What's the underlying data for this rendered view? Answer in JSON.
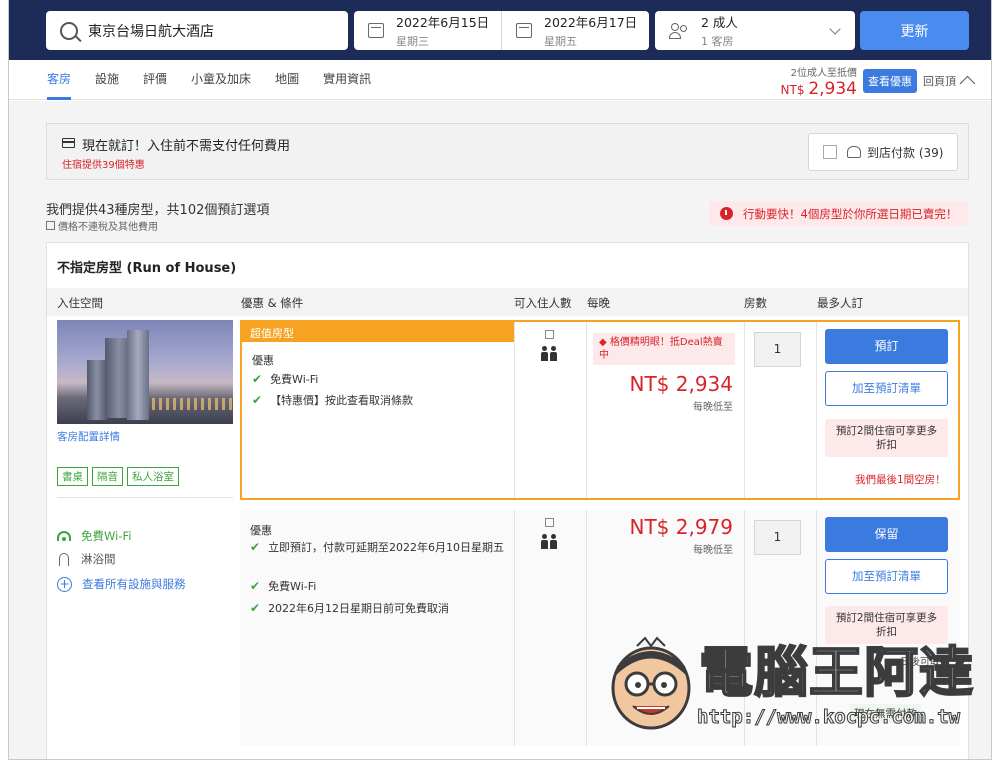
{
  "search": {
    "destination": "東京台場日航大酒店",
    "checkin_date": "2022年6月15日",
    "checkin_day": "星期三",
    "checkout_date": "2022年6月17日",
    "checkout_day": "星期五",
    "guests": "2 成人",
    "rooms": "1 客房",
    "update_label": "更新"
  },
  "nav": {
    "tabs": [
      "客房",
      "設施",
      "評價",
      "小童及加床",
      "地圖",
      "實用資訊"
    ],
    "active_tab": 0,
    "price_note": "2位成人至抵價",
    "price_currency": "NT$",
    "price_value": "2,934",
    "view_deal_label": "查看優惠",
    "back_top_label": "回頁頂"
  },
  "banner": {
    "title": "現在就訂！入住前不需支付任何費用",
    "subtitle": "住宿提供39個特惠",
    "pay_at_hotel": "到店付款 (39)"
  },
  "summary": {
    "title": "我們提供43種房型，共102個預訂選項",
    "note": "價格不連稅及其他費用",
    "soldout_alert": "行動要快！4個房型於你所選日期已賣完！"
  },
  "room": {
    "name": "不指定房型 (Run of House)",
    "columns": {
      "space": "入住空間",
      "offer": "優惠 & 條件",
      "occupancy": "可入住人數",
      "per_night": "每晚",
      "rooms": "房數",
      "most_booked": "最多人訂"
    },
    "detail_link": "客房配置詳情",
    "chips": [
      "書桌",
      "隔音",
      "私人浴室"
    ],
    "amenities": [
      {
        "icon": "wifi-icon",
        "label": "免費Wi-Fi",
        "color": "#3da43d"
      },
      {
        "icon": "shower-icon",
        "label": "淋浴間",
        "color": "#555555"
      },
      {
        "icon": "plus-circle-icon",
        "label": "查看所有設施與服務",
        "color": "#3b7be0"
      }
    ]
  },
  "offers": [
    {
      "tag": "超值房型",
      "perk_head": "優惠",
      "perks": [
        "免費Wi-Fi",
        "【特惠價】按此查看取消條款"
      ],
      "hot_tag": "格價精明眼！抵Deal熱賣中",
      "price": "NT$ 2,934",
      "price_unit": "每晚低至",
      "qty": "1",
      "book_label": "預訂",
      "list_label": "加至預訂清單",
      "promo": "預訂2間住宿可享更多折扣",
      "last_room": "我們最後1間空房！"
    },
    {
      "perk_head": "優惠",
      "perks": [
        "立即預訂，付款可延期至2022年6月10日星期五",
        "免費Wi-Fi",
        "2022年6月12日星期日前可免費取消"
      ],
      "price": "NT$ 2,979",
      "price_unit": "每晚低至",
      "qty": "1",
      "book_label": "保留",
      "list_label": "加至預訂清單",
      "promo": "預訂2間住宿可享更多折扣",
      "cancel_note": "日後可取消",
      "no_pay_now": "現在無需付款"
    }
  ],
  "watermark": {
    "title": "電腦王阿達",
    "url": "http://www.kocpc.com.tw"
  },
  "colors": {
    "header_bg": "#1d2b59",
    "accent_blue": "#3b7be0",
    "price_red": "#d8232a",
    "deal_orange": "#f6a322",
    "check_green": "#3da43d"
  }
}
